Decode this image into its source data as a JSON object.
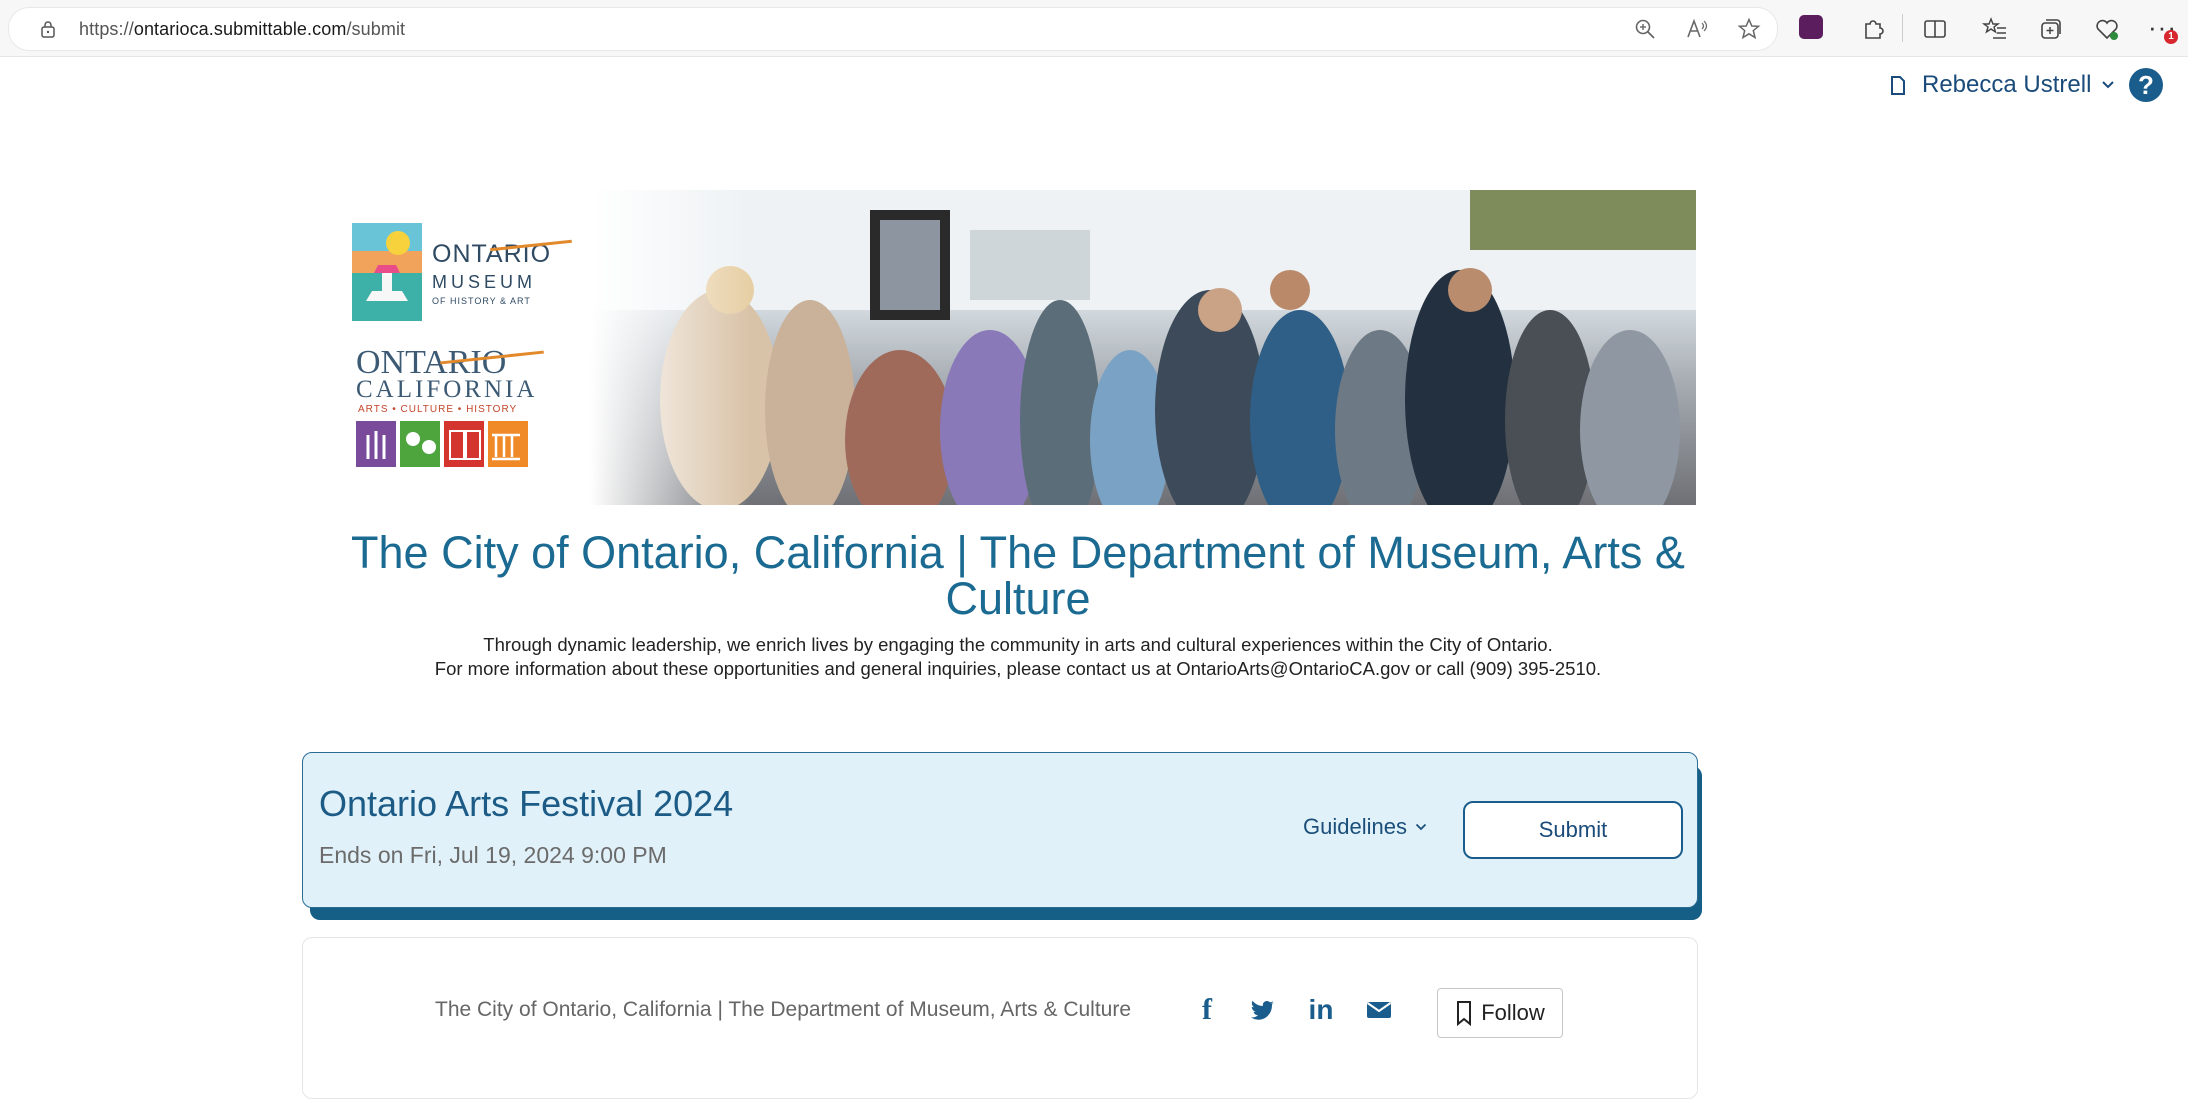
{
  "browser": {
    "url_scheme": "https://",
    "url_host": "ontarioca.submittable.com",
    "url_path": "/submit",
    "notification_count": "1"
  },
  "header": {
    "user_name": "Rebecca Ustrell",
    "help_label": "?"
  },
  "logos": {
    "museum_line1": "ONTARIO",
    "museum_line2": "MUSEUM",
    "museum_line3": "OF HISTORY & ART",
    "city_line1": "ONTARIO",
    "city_line2": "CALIFORNIA",
    "city_line3": "ARTS • CULTURE • HISTORY"
  },
  "main": {
    "title": "The City of Ontario, California | The Department of Museum, Arts & Culture",
    "tagline_line1": "Through dynamic leadership, we enrich lives by engaging the community in arts and cultural experiences within the City of Ontario.",
    "tagline_line2": "For more information about these opportunities and general inquiries, please contact us at OntarioArts@OntarioCA.gov or call (909) 395-2510."
  },
  "opportunity": {
    "title": "Ontario Arts Festival 2024",
    "deadline": "Ends on Fri, Jul 19, 2024 9:00 PM",
    "guidelines_label": "Guidelines",
    "submit_label": "Submit"
  },
  "org_bar": {
    "org_name": "The City of Ontario, California | The Department of Museum, Arts & Culture",
    "social_facebook": "f",
    "social_linkedin": "in",
    "follow_label": "Follow"
  },
  "colors": {
    "brand_blue": "#1b6a92",
    "card_bg": "#e1f1f9",
    "card_shadow": "#155e86"
  }
}
